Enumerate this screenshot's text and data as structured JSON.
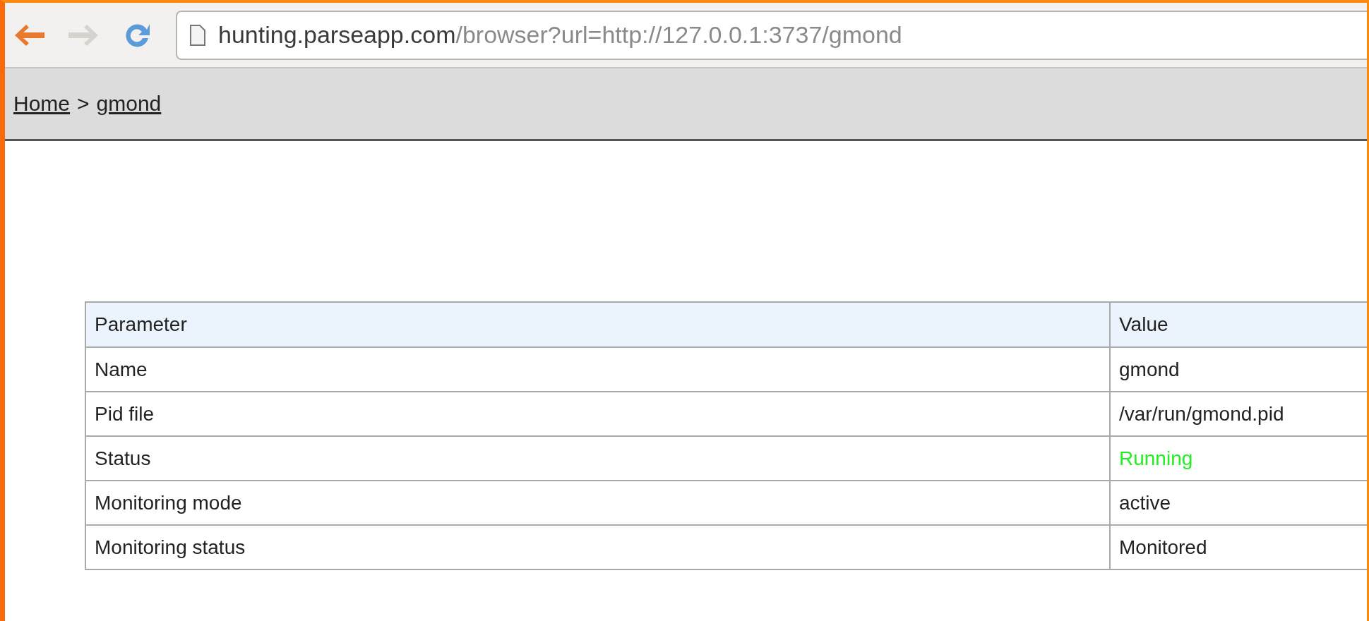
{
  "toolbar": {
    "back": {
      "disabled": false
    },
    "forward": {
      "disabled": true
    },
    "url": {
      "host": "hunting.parseapp.com",
      "path": "/browser?url=http://127.0.0.1:3737/gmond"
    }
  },
  "breadcrumb": [
    {
      "label": "Home"
    },
    {
      "label": "gmond"
    }
  ],
  "breadcrumb_separator": ">",
  "table": {
    "columns": [
      "Parameter",
      "Value"
    ],
    "rows": [
      {
        "parameter": "Name",
        "value": "gmond"
      },
      {
        "parameter": "Pid file",
        "value": "/var/run/gmond.pid"
      },
      {
        "parameter": "Status",
        "value": "Running",
        "color": "#22ee22"
      },
      {
        "parameter": "Monitoring mode",
        "value": "active"
      },
      {
        "parameter": "Monitoring status",
        "value": "Monitored"
      }
    ]
  }
}
